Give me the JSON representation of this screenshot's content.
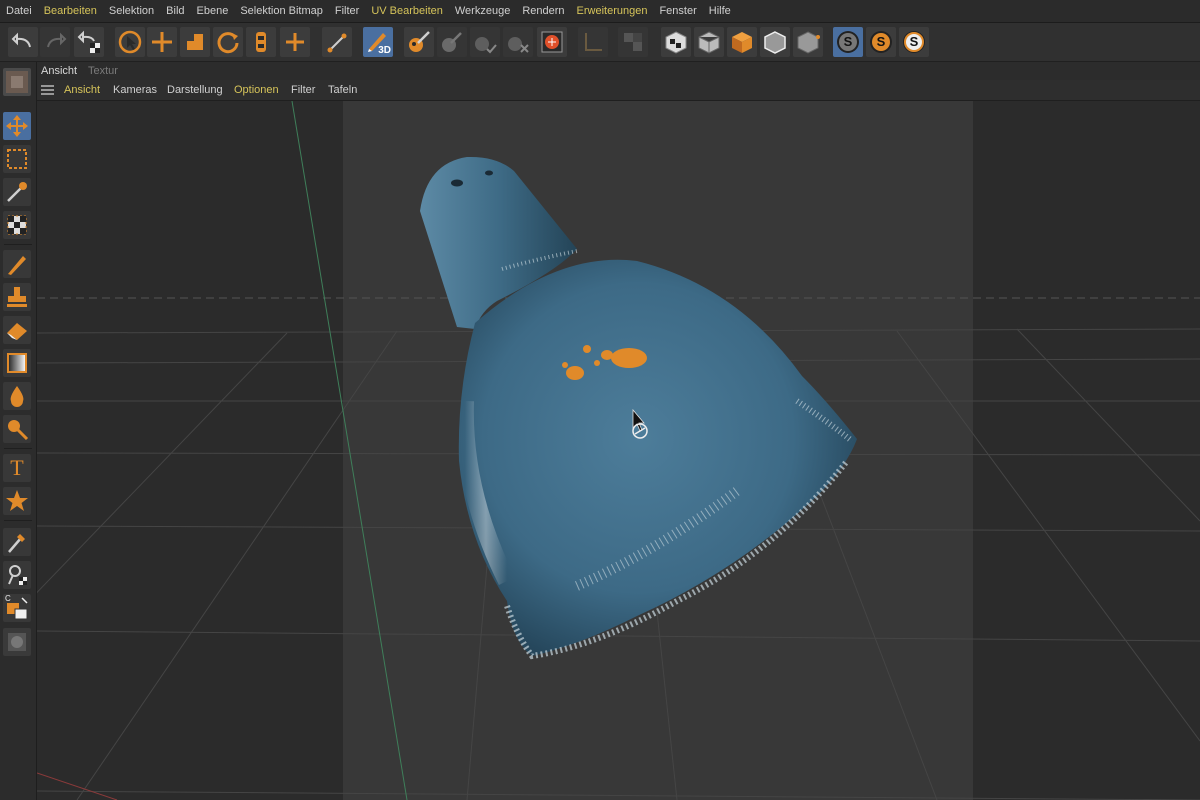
{
  "menubar": {
    "items": [
      {
        "label": "Datei",
        "highlight": false
      },
      {
        "label": "Bearbeiten",
        "highlight": true
      },
      {
        "label": "Selektion",
        "highlight": false
      },
      {
        "label": "Bild",
        "highlight": false
      },
      {
        "label": "Ebene",
        "highlight": false
      },
      {
        "label": "Selektion Bitmap",
        "highlight": false
      },
      {
        "label": "Filter",
        "highlight": false
      },
      {
        "label": "UV Bearbeiten",
        "highlight": true
      },
      {
        "label": "Werkzeuge",
        "highlight": false
      },
      {
        "label": "Rendern",
        "highlight": false
      },
      {
        "label": "Erweiterungen",
        "highlight": true
      },
      {
        "label": "Fenster",
        "highlight": false
      },
      {
        "label": "Hilfe",
        "highlight": false
      }
    ]
  },
  "toolbar": {
    "paint3d_badge": "3D",
    "solo_labels": [
      "S",
      "S",
      "S"
    ]
  },
  "viewport_tabs": {
    "ansicht": "Ansicht",
    "textur": "Textur"
  },
  "viewport_menu": {
    "ansicht": "Ansicht",
    "kameras": "Kameras",
    "darstellung": "Darstellung",
    "optionen": "Optionen",
    "filter": "Filter",
    "tafeln": "Tafeln"
  },
  "sidebar": {
    "text_tool_glyph": "T",
    "color_label": "C"
  },
  "colors": {
    "accent_orange": "#e08a2a",
    "highlight_yellow": "#d6c45a",
    "active_blue": "#4a6fa0",
    "lamp_blue": "#3d6a86"
  }
}
